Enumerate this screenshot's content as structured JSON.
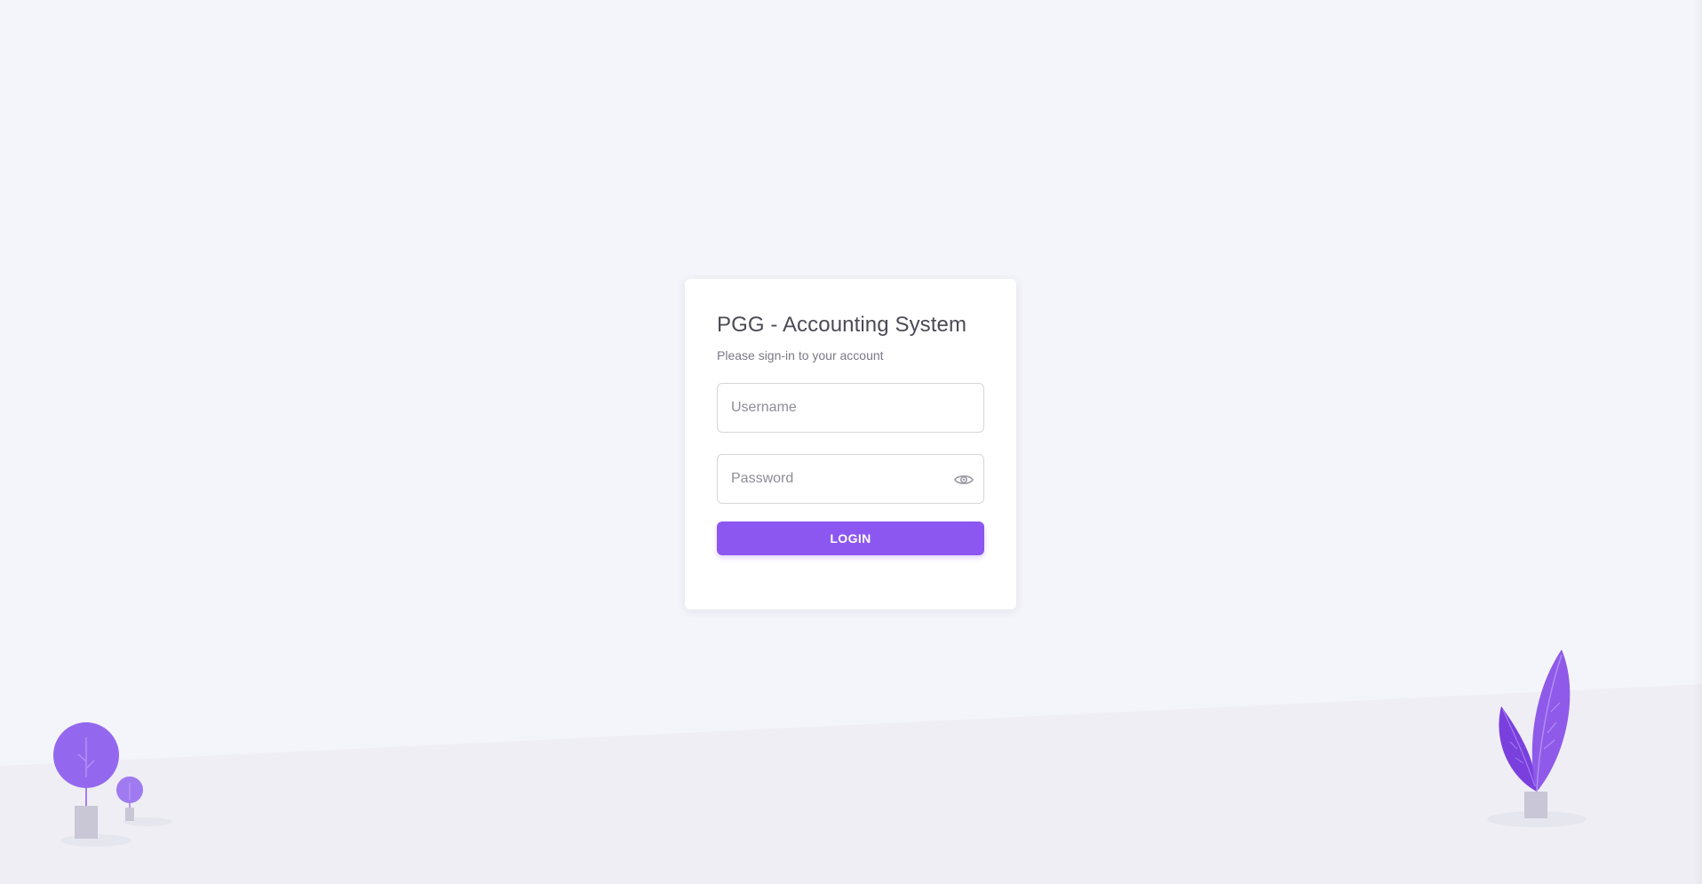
{
  "login": {
    "title": "PGG - Accounting System",
    "subtitle": "Please sign-in to your account",
    "username_placeholder": "Username",
    "password_placeholder": "Password",
    "login_label": "LOGIN",
    "show_password_icon": "eye-icon"
  },
  "theme": {
    "primary": "#8c57f0",
    "background": "#f4f5fa",
    "floor": "#eeeef4",
    "plant_pot": "#c9c6d6"
  },
  "decorations": {
    "left_illustration": "tree-plant-icon",
    "right_illustration": "leaf-plant-icon"
  }
}
